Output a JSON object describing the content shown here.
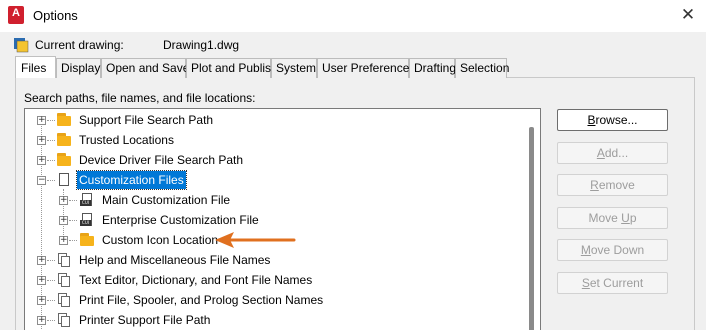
{
  "window": {
    "title": "Options",
    "app_icon_letter": "A"
  },
  "current_drawing": {
    "label": "Current drawing:",
    "value": "Drawing1.dwg"
  },
  "tabs": [
    {
      "label": "Files",
      "active": true
    },
    {
      "label": "Display"
    },
    {
      "label": "Open and Save"
    },
    {
      "label": "Plot and Publish"
    },
    {
      "label": "System"
    },
    {
      "label": "User Preferences"
    },
    {
      "label": "Drafting"
    },
    {
      "label": "Selection"
    }
  ],
  "section_label": "Search paths, file names, and file locations:",
  "tree": [
    {
      "label": "Support File Search Path",
      "icon": "folder-icon",
      "level": 0
    },
    {
      "label": "Trusted Locations",
      "icon": "folder-icon",
      "level": 0
    },
    {
      "label": "Device Driver File Search Path",
      "icon": "folder-icon",
      "level": 0
    },
    {
      "label": "Customization Files",
      "icon": "page-icon",
      "level": 0,
      "expanded": true,
      "selected": true
    },
    {
      "label": "Main Customization File",
      "icon": "cui-file-icon",
      "level": 1,
      "tag": "CUI"
    },
    {
      "label": "Enterprise Customization File",
      "icon": "cui-file-icon",
      "level": 1,
      "tag": "CUI"
    },
    {
      "label": "Custom Icon Location",
      "icon": "folder-icon",
      "level": 1
    },
    {
      "label": "Help and Miscellaneous File Names",
      "icon": "multipage-icon",
      "level": 0
    },
    {
      "label": "Text Editor, Dictionary, and Font File Names",
      "icon": "multipage-icon",
      "level": 0
    },
    {
      "label": "Print File, Spooler, and Prolog Section Names",
      "icon": "multipage-icon",
      "level": 0
    },
    {
      "label": "Printer Support File Path",
      "icon": "multipage-icon",
      "level": 0
    }
  ],
  "buttons": {
    "browse": {
      "prefix": "",
      "mnemonic": "B",
      "rest": "rowse..."
    },
    "add": {
      "prefix": "",
      "mnemonic": "A",
      "rest": "dd..."
    },
    "remove": {
      "prefix": "",
      "mnemonic": "R",
      "rest": "emove"
    },
    "move_up": {
      "prefix": "Move ",
      "mnemonic": "U",
      "rest": "p"
    },
    "move_down": {
      "prefix": "",
      "mnemonic": "M",
      "rest": "ove Down"
    },
    "set_current": {
      "prefix": "",
      "mnemonic": "S",
      "rest": "et Current"
    }
  },
  "colors": {
    "accent": "#0078d7",
    "arrow": "#e0701f",
    "app_icon": "#d0202e"
  }
}
